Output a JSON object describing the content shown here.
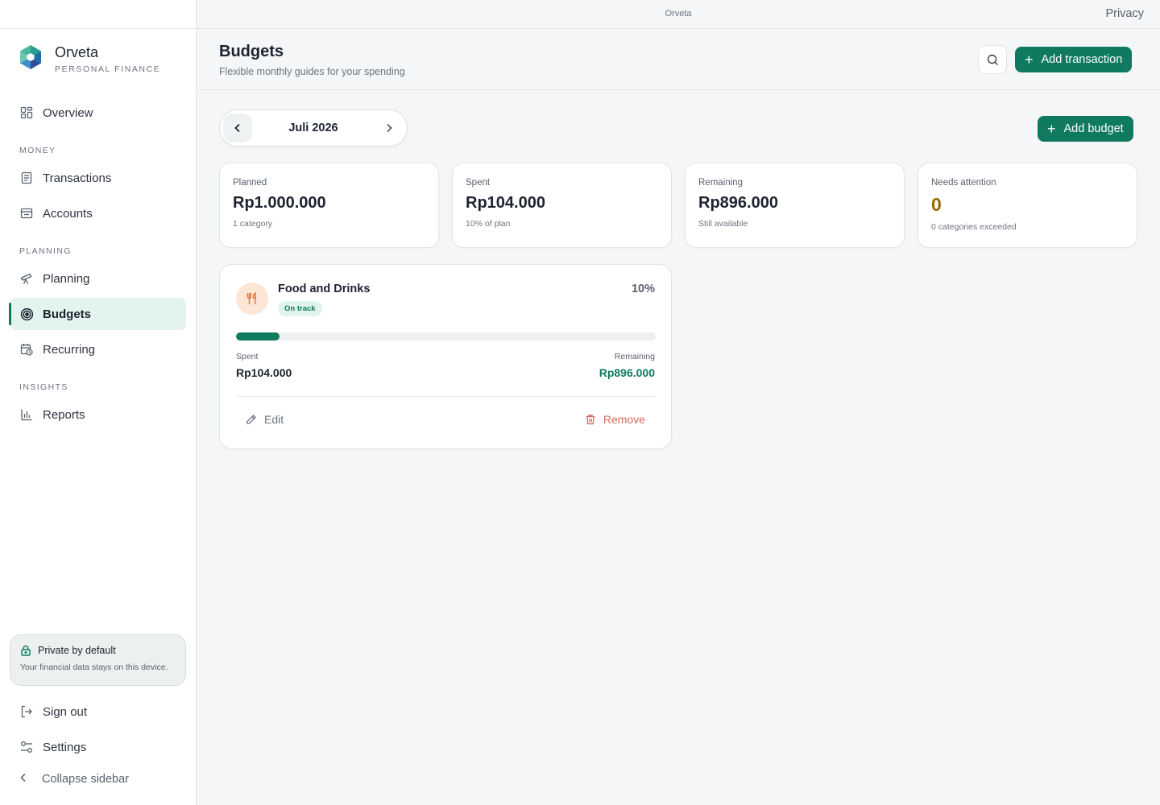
{
  "app": {
    "name": "Orveta",
    "tagline": "PERSONAL FINANCE",
    "topbar_center": "Orveta",
    "topbar_right": "Privacy"
  },
  "sidebar": {
    "overview": "Overview",
    "sections": {
      "money": "MONEY",
      "planning": "PLANNING",
      "insights": "INSIGHTS"
    },
    "items": {
      "transactions": "Transactions",
      "accounts": "Accounts",
      "planning": "Planning",
      "budgets": "Budgets",
      "recurring": "Recurring",
      "reports": "Reports"
    },
    "privacy": {
      "title": "Private by default",
      "text": "Your financial data stays on this device."
    },
    "sign_out": "Sign out",
    "settings": "Settings",
    "collapse": "Collapse sidebar"
  },
  "header": {
    "title": "Budgets",
    "subtitle": "Flexible monthly guides for your spending",
    "add_transaction": "Add transaction"
  },
  "month_switcher": {
    "label": "Juli 2026"
  },
  "add_budget": "Add budget",
  "stats": {
    "planned": {
      "label": "Planned",
      "value": "Rp1.000.000",
      "note": "1 category"
    },
    "spent": {
      "label": "Spent",
      "value": "Rp104.000",
      "note": "10% of plan"
    },
    "remaining": {
      "label": "Remaining",
      "value": "Rp896.000",
      "note": "Still available"
    },
    "attention": {
      "label": "Needs attention",
      "value": "0",
      "note": "0 categories exceeded"
    }
  },
  "budget_card": {
    "category": "Food and Drinks",
    "status": "On track",
    "percent_label": "10%",
    "progress_fraction": 0.104,
    "spent_label": "Spent",
    "spent_value": "Rp104.000",
    "remaining_label": "Remaining",
    "remaining_value": "Rp896.000",
    "edit": "Edit",
    "remove": "Remove"
  },
  "colors": {
    "accent": "#0f7a5f",
    "warning": "#9a6a00",
    "danger": "#d86a5a",
    "category_icon_bg": "#fde6d6",
    "category_icon": "#e07a3a"
  },
  "icons": {
    "overview": "grid-icon",
    "transactions": "receipt-icon",
    "accounts": "wallet-icon",
    "planning": "telescope-icon",
    "budgets": "target-icon",
    "recurring": "calendar-clock-icon",
    "reports": "bar-chart-icon",
    "privacy": "lock-icon",
    "sign_out": "sign-out-icon",
    "settings": "sliders-icon",
    "category": "utensils-icon"
  }
}
